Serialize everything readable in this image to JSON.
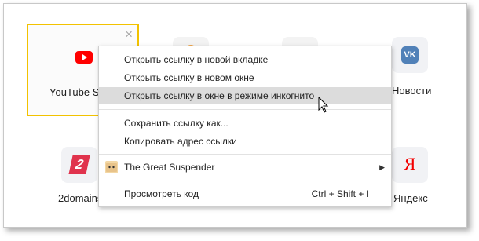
{
  "tiles": {
    "youtube": {
      "label": "YouTube St",
      "close": "×"
    },
    "vk": {
      "label": "Новости",
      "letter": "VK"
    },
    "twodomains": {
      "label": "2domains",
      "letter": "2"
    },
    "yandex": {
      "label": "Яндекс",
      "letter": "Я"
    }
  },
  "context_menu": {
    "items": [
      {
        "label": "Открыть ссылку в новой вкладке"
      },
      {
        "label": "Открыть ссылку в новом окне"
      },
      {
        "label": "Открыть ссылку в окне в режиме инкогнито"
      },
      {
        "label": "Сохранить ссылку как..."
      },
      {
        "label": "Копировать адрес ссылки"
      },
      {
        "label": "The Great Suspender",
        "submenu_arrow": "▶"
      },
      {
        "label": "Просмотреть код",
        "shortcut": "Ctrl + Shift + I"
      }
    ]
  },
  "colors": {
    "selected_border": "#f2c200",
    "youtube_red": "#ff0000",
    "vk_blue": "#5181b8",
    "twodomains_red": "#e0334d",
    "yandex_red": "#f30000",
    "highlight": "#dcdcdc"
  }
}
